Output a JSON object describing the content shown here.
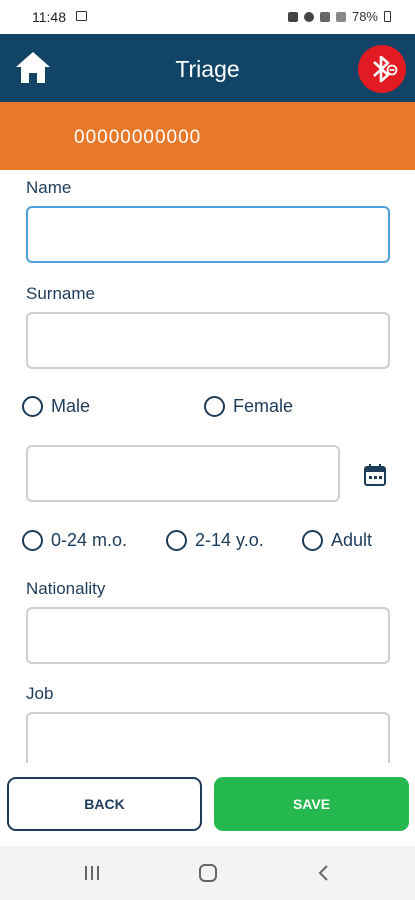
{
  "status_bar": {
    "time": "11:48",
    "battery": "78%",
    "icons": [
      "image-icon",
      "mute-icon",
      "location-icon",
      "wifi-icon",
      "signal-icon",
      "battery-icon"
    ]
  },
  "app_bar": {
    "title": "Triage",
    "home_icon": "home-icon",
    "bluetooth_icon": "bluetooth-disconnected-icon",
    "background": "#114467",
    "bluetooth_color": "#e21a21"
  },
  "banner": {
    "id": "00000000000",
    "background": "#e8782a"
  },
  "form": {
    "name_label": "Name",
    "name_value": "",
    "surname_label": "Surname",
    "surname_value": "",
    "gender_options": {
      "male": "Male",
      "female": "Female"
    },
    "date_value": "",
    "date_icon": "calendar-icon",
    "age_options": {
      "infant": "0-24 m.o.",
      "child": "2-14 y.o.",
      "adult": "Adult"
    },
    "nationality_label": "Nationality",
    "nationality_value": "",
    "job_label": "Job",
    "job_value": ""
  },
  "actions": {
    "back_label": "BACK",
    "save_label": "SAVE",
    "save_color": "#24b84f"
  },
  "nav_bar": {
    "icons": [
      "recents-icon",
      "home-nav-icon",
      "back-nav-icon"
    ]
  }
}
